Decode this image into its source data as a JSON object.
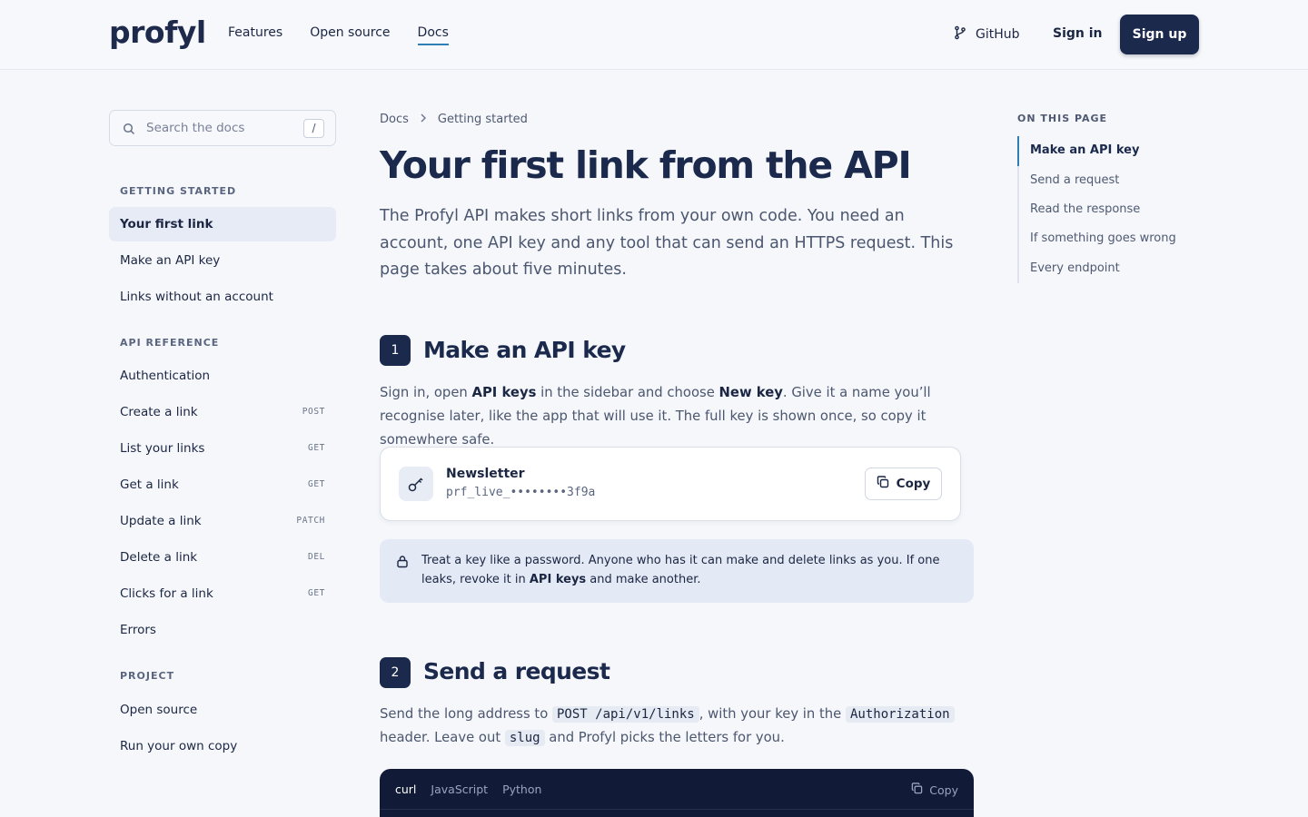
{
  "header": {
    "logo": "profyl",
    "nav": [
      {
        "label": "Features"
      },
      {
        "label": "Open source"
      },
      {
        "label": "Docs"
      }
    ],
    "github": "GitHub",
    "signin": "Sign in",
    "signup": "Sign up"
  },
  "sidebar": {
    "search_placeholder": "Search the docs",
    "search_shortcut": "/",
    "sections": [
      {
        "title": "GETTING STARTED",
        "items": [
          {
            "label": "Your first link",
            "method": ""
          },
          {
            "label": "Make an API key",
            "method": ""
          },
          {
            "label": "Links without an account",
            "method": ""
          }
        ]
      },
      {
        "title": "API REFERENCE",
        "items": [
          {
            "label": "Authentication",
            "method": ""
          },
          {
            "label": "Create a link",
            "method": "POST"
          },
          {
            "label": "List your links",
            "method": "GET"
          },
          {
            "label": "Get a link",
            "method": "GET"
          },
          {
            "label": "Update a link",
            "method": "PATCH"
          },
          {
            "label": "Delete a link",
            "method": "DEL"
          },
          {
            "label": "Clicks for a link",
            "method": "GET"
          },
          {
            "label": "Errors",
            "method": ""
          }
        ]
      },
      {
        "title": "PROJECT",
        "items": [
          {
            "label": "Open source",
            "method": ""
          },
          {
            "label": "Run your own copy",
            "method": ""
          }
        ]
      }
    ]
  },
  "main": {
    "breadcrumb": [
      "Docs",
      "Getting started"
    ],
    "title": "Your first link from the API",
    "lead": "The Profyl API makes short links from your own code. You need an account, one API key and any tool that can send an HTTPS request. This page takes about five minutes.",
    "step1": {
      "number": "1",
      "title": "Make an API key",
      "p_a": "Sign in, open ",
      "p_b": "API keys",
      "p_c": " in the sidebar and choose ",
      "p_d": "New key",
      "p_e": ". Give it a name you’ll recognise later, like the app that will use it. The full key is shown once, so copy it somewhere safe.",
      "key_name": "Newsletter",
      "key_value": "prf_live_••••••••3f9a",
      "copy": "Copy",
      "note_a": "Treat a key like a password. Anyone who has it can make and delete links as you. If one leaks, revoke it in ",
      "note_b": "API keys",
      "note_c": " and make another."
    },
    "step2": {
      "number": "2",
      "title": "Send a request",
      "p_a": "Send the long address to ",
      "code_a": "POST /api/v1/links",
      "p_b": ", with your key in the ",
      "code_b": "Authorization",
      "p_c": " header. Leave out ",
      "code_c": "slug",
      "p_d": " and Profyl picks the letters for you.",
      "tabs": [
        "curl",
        "JavaScript",
        "Python"
      ],
      "copy": "Copy"
    }
  },
  "toc": {
    "heading": "ON THIS PAGE",
    "items": [
      "Make an API key",
      "Send a request",
      "Read the response",
      "If something goes wrong",
      "Every endpoint"
    ]
  },
  "colors": {
    "accent": "#2f7fb4",
    "navy": "#1b2a4c",
    "background": "#f5f7fb"
  }
}
